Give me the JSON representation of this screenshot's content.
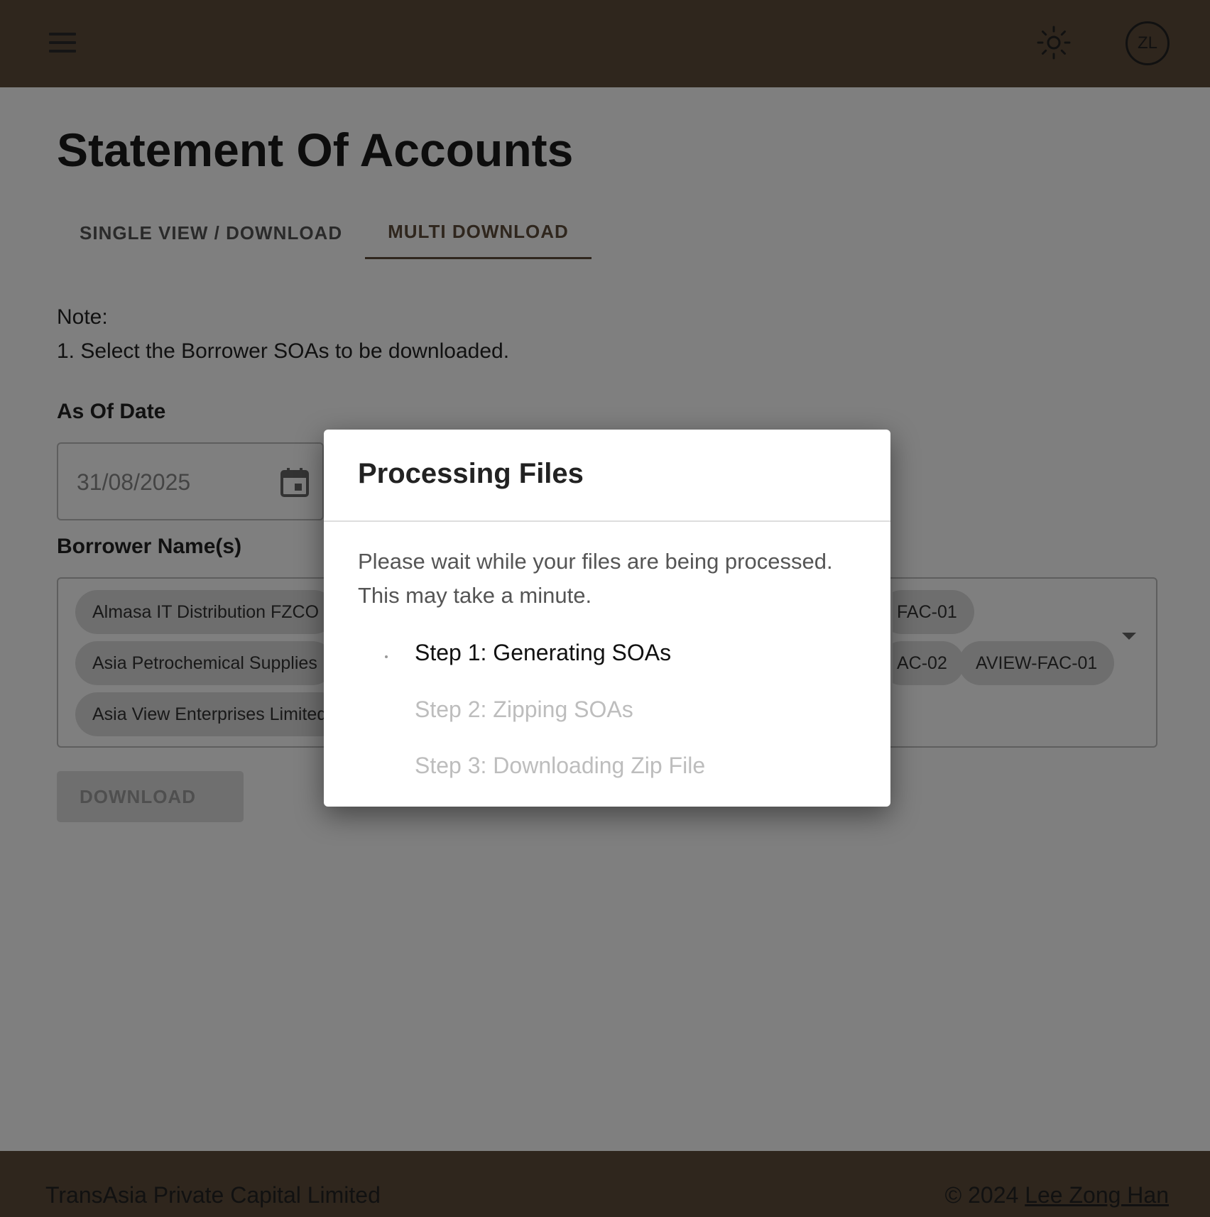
{
  "header": {
    "menu_icon": "hamburger-menu-icon",
    "theme_icon": "sun-icon",
    "avatar_initials": "ZL"
  },
  "page": {
    "title": "Statement Of Accounts",
    "tabs": [
      {
        "label": "SINGLE VIEW / DOWNLOAD",
        "active": false
      },
      {
        "label": "MULTI DOWNLOAD",
        "active": true
      }
    ],
    "note_heading": "Note:",
    "note_line1": "1. Select the Borrower SOAs to be downloaded."
  },
  "form": {
    "as_of_date_label": "As Of Date",
    "as_of_date_value": "31/08/2025",
    "borrower_label": "Borrower Name(s)",
    "chips": [
      "Almasa IT Distribution FZCO",
      "FAC-01",
      "Asia Petrochemical Supplies",
      "AC-02",
      "AVIEW-FAC-01",
      "Asia View Enterprises Limited"
    ],
    "download_label": "DOWNLOAD"
  },
  "dialog": {
    "title": "Processing Files",
    "message": "Please wait while your files are being processed. This may take a minute.",
    "steps": [
      {
        "label": "Step 1: Generating SOAs",
        "status": "in-progress"
      },
      {
        "label": "Step 2: Zipping SOAs",
        "status": "pending"
      },
      {
        "label": "Step 3: Downloading Zip File",
        "status": "pending"
      }
    ]
  },
  "footer": {
    "company": "TransAsia Private Capital Limited",
    "copyright_prefix": "© 2024 ",
    "author_link": "Lee Zong Han"
  },
  "colors": {
    "brand": "#5e4c3b",
    "overlay": "rgba(0,0,0,0.5)"
  }
}
